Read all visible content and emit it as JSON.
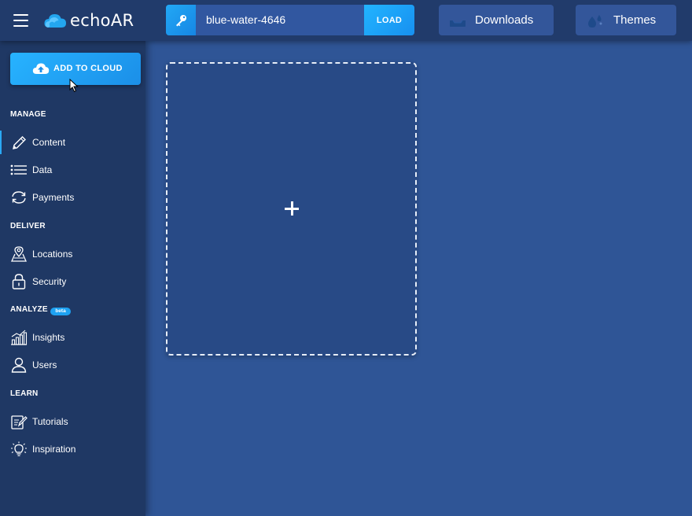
{
  "header": {
    "brand": "echoAR",
    "key_value": "blue-water-4646",
    "load_label": "LOAD",
    "downloads_label": "Downloads",
    "themes_label": "Themes"
  },
  "sidebar": {
    "add_to_cloud_label": "ADD TO CLOUD",
    "sections": {
      "manage": "MANAGE",
      "deliver": "DELIVER",
      "analyze": "ANALYZE",
      "analyze_badge": "beta",
      "learn": "LEARN"
    },
    "items": [
      {
        "label": "Content",
        "icon": "pencil-icon",
        "active": true
      },
      {
        "label": "Data",
        "icon": "list-icon"
      },
      {
        "label": "Payments",
        "icon": "refresh-icon"
      },
      {
        "label": "Locations",
        "icon": "map-pin-icon"
      },
      {
        "label": "Security",
        "icon": "lock-icon"
      },
      {
        "label": "Insights",
        "icon": "bar-chart-icon"
      },
      {
        "label": "Users",
        "icon": "user-icon"
      },
      {
        "label": "Tutorials",
        "icon": "edit-document-icon"
      },
      {
        "label": "Inspiration",
        "icon": "lightbulb-icon"
      }
    ]
  },
  "main": {
    "dropzone_icon": "plus-icon"
  },
  "colors": {
    "topbar": "#213b6b",
    "sidebar": "#1f3864",
    "main_bg": "#2f5596",
    "accent": "#1ea2f2"
  }
}
